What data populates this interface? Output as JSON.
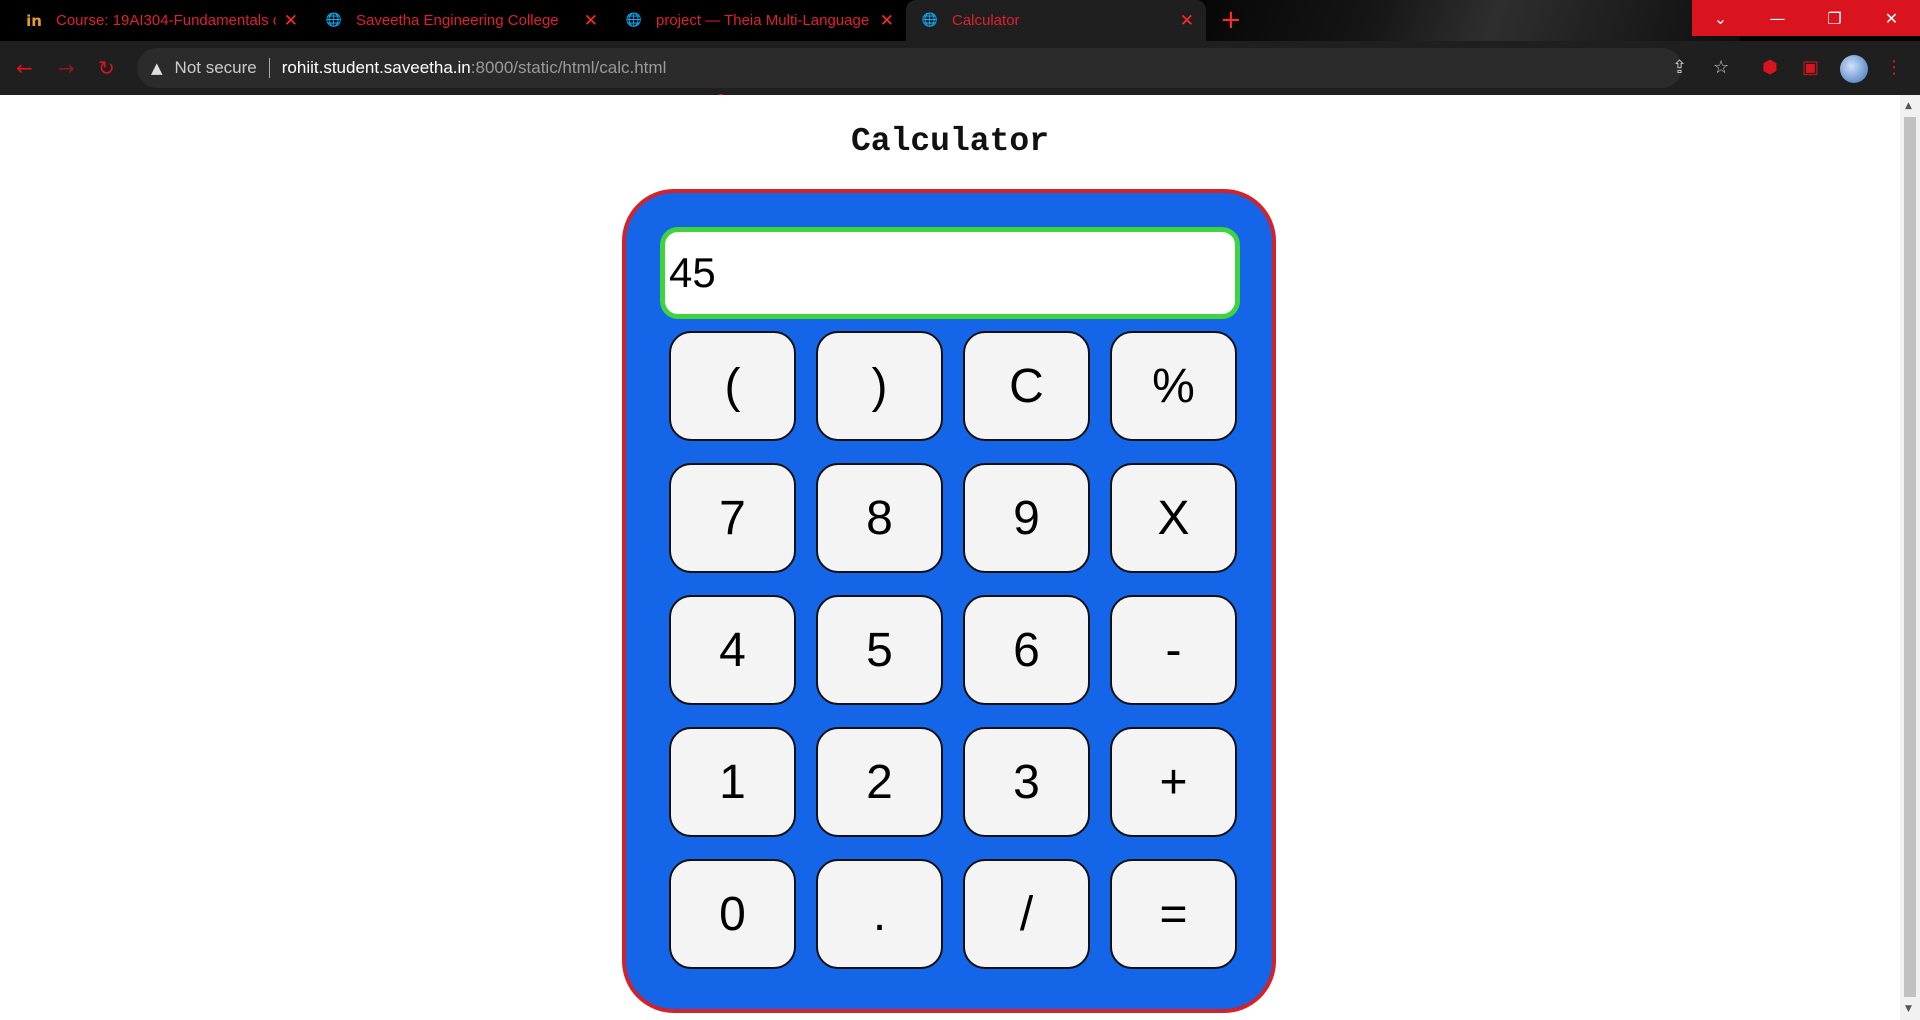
{
  "browser": {
    "tabs": [
      {
        "title": "Course: 19AI304-Fundamentals o",
        "favicon": "in",
        "active": false
      },
      {
        "title": "Saveetha Engineering College",
        "favicon": "globe-icon",
        "active": false
      },
      {
        "title": "project — Theia Multi-Language",
        "favicon": "globe-icon",
        "active": false
      },
      {
        "title": "Calculator",
        "favicon": "globe-icon",
        "active": true
      }
    ],
    "close_glyph": "✕",
    "newtab_glyph": "+",
    "address": {
      "security_label": "Not secure",
      "host": "rohiit.student.saveetha.in",
      "path": ":8000/static/html/calc.html"
    },
    "accent_color": "#d9141f"
  },
  "page": {
    "heading": "Calculator",
    "display_value": "45",
    "keys": [
      "(",
      ")",
      "C",
      "%",
      "7",
      "8",
      "9",
      "X",
      "4",
      "5",
      "6",
      "-",
      "1",
      "2",
      "3",
      "+",
      "0",
      ".",
      "/",
      "="
    ],
    "colors": {
      "body": "#1565e8",
      "border": "#d3222a",
      "display_border": "#3fd43a",
      "key": "#f4f4f4"
    }
  }
}
